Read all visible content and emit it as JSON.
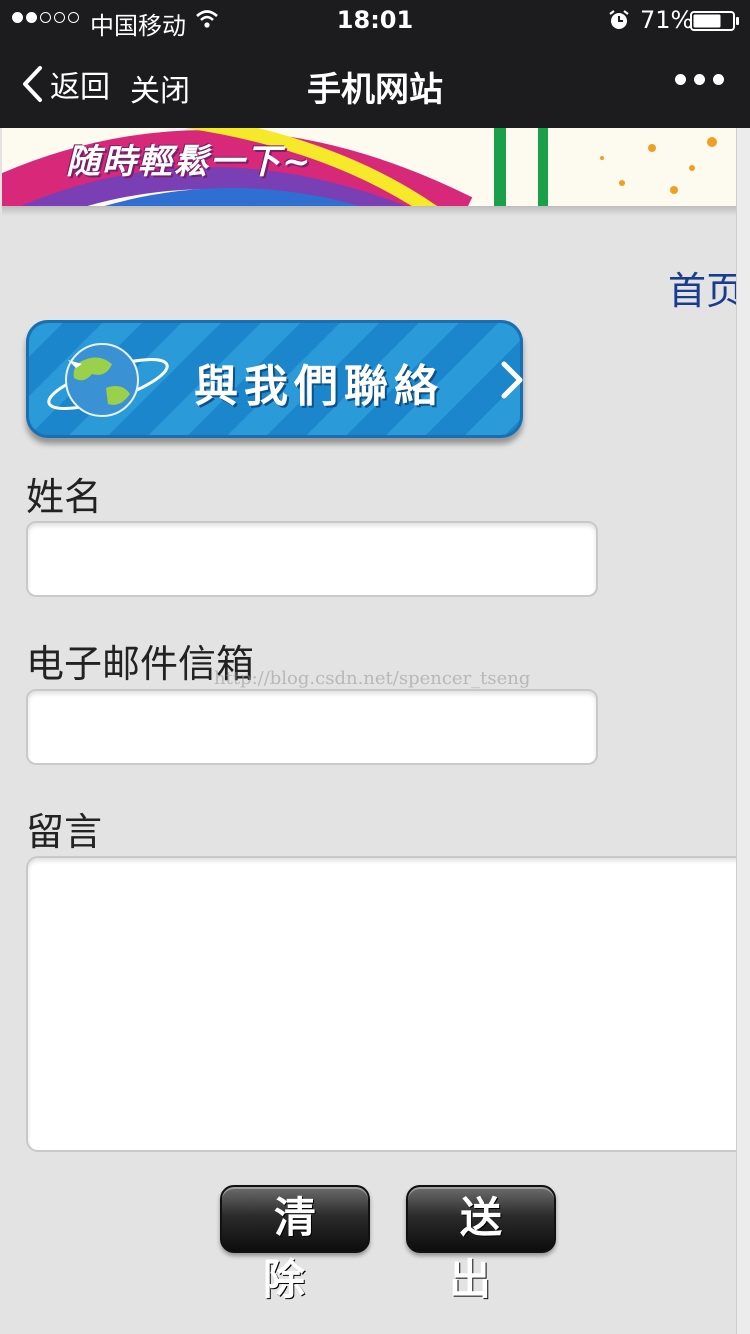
{
  "status_bar": {
    "carrier": "中国移动",
    "time": "18:01",
    "battery": "71%",
    "battery_level": 0.71,
    "signal_bars_filled": 2,
    "signal_bars_total": 5
  },
  "nav": {
    "back_label": "返回",
    "close_label": "关闭",
    "title": "手机网站"
  },
  "banner": {
    "text": "随時輕鬆一下~"
  },
  "home_link": "首页",
  "contact_banner": {
    "text": "與我們聯絡"
  },
  "form": {
    "name_label": "姓名",
    "name_value": "",
    "email_label": "电子邮件信箱",
    "email_value": "",
    "message_label": "留言",
    "message_value": "",
    "clear_label": "清除",
    "submit_label": "送出"
  },
  "watermark": "http://blog.csdn.net/spencer_tseng",
  "colors": {
    "bar_background": "#1c1c1e",
    "page_background": "#e3e3e3",
    "link": "#1a3c8f",
    "contact_banner_blue": "#2a9ad9"
  }
}
